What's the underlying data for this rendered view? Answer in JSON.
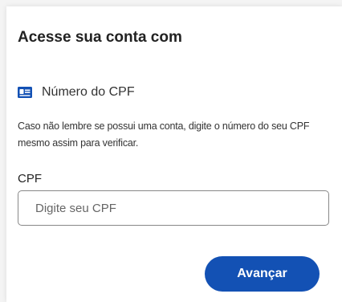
{
  "heading": "Acesse sua conta com",
  "method": {
    "icon": "id-card-icon",
    "label": "Número do CPF"
  },
  "help_text": "Caso não lembre se possui uma conta, digite o número do seu CPF mesmo assim para verificar.",
  "cpf_field": {
    "label": "CPF",
    "placeholder": "Digite seu CPF",
    "value": ""
  },
  "submit_label": "Avançar",
  "colors": {
    "primary": "#1351b4",
    "icon": "#1351b4"
  }
}
